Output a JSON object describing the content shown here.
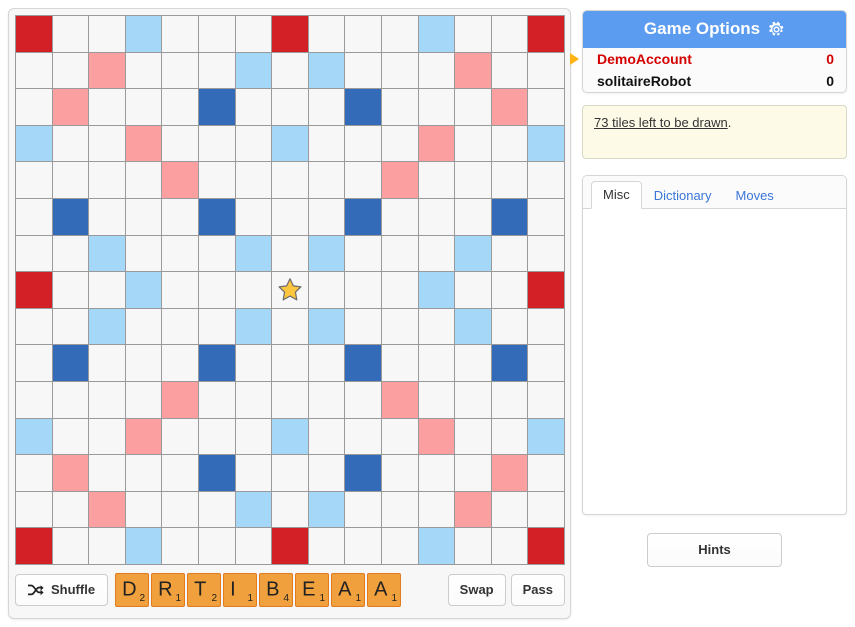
{
  "board": {
    "size": 15,
    "center_icon": "star-icon",
    "legend": {
      "tw": "triple-word",
      "dw": "double-word",
      "tl": "triple-letter",
      "dl": "double-letter"
    },
    "colors": {
      "triple_word": "#d32027",
      "double_word": "#fb9fa0",
      "triple_letter": "#336bb8",
      "double_letter": "#a5d7f9",
      "empty": "#f7f7f7",
      "grid_line": "#9a9a9a"
    },
    "premium_map": [
      [
        "tw",
        "",
        "",
        "dl",
        "",
        "",
        "",
        "tw",
        "",
        "",
        "",
        "dl",
        "",
        "",
        "tw"
      ],
      [
        "",
        "",
        "dw",
        "",
        "",
        "",
        "dl",
        "",
        "dl",
        "",
        "",
        "",
        "dw",
        "",
        ""
      ],
      [
        "",
        "dw",
        "",
        "",
        "",
        "tl",
        "",
        "",
        "",
        "tl",
        "",
        "",
        "",
        "dw",
        ""
      ],
      [
        "dl",
        "",
        "",
        "dw",
        "",
        "",
        "",
        "dl",
        "",
        "",
        "",
        "dw",
        "",
        "",
        "dl"
      ],
      [
        "",
        "",
        "",
        "",
        "dw",
        "",
        "",
        "",
        "",
        "",
        "dw",
        "",
        "",
        "",
        ""
      ],
      [
        "",
        "tl",
        "",
        "",
        "",
        "tl",
        "",
        "",
        "",
        "tl",
        "",
        "",
        "",
        "tl",
        ""
      ],
      [
        "",
        "",
        "dl",
        "",
        "",
        "",
        "dl",
        "",
        "dl",
        "",
        "",
        "",
        "dl",
        "",
        ""
      ],
      [
        "tw",
        "",
        "",
        "dl",
        "",
        "",
        "",
        "center",
        "",
        "",
        "",
        "dl",
        "",
        "",
        "tw"
      ],
      [
        "",
        "",
        "dl",
        "",
        "",
        "",
        "dl",
        "",
        "dl",
        "",
        "",
        "",
        "dl",
        "",
        ""
      ],
      [
        "",
        "tl",
        "",
        "",
        "",
        "tl",
        "",
        "",
        "",
        "tl",
        "",
        "",
        "",
        "tl",
        ""
      ],
      [
        "",
        "",
        "",
        "",
        "dw",
        "",
        "",
        "",
        "",
        "",
        "dw",
        "",
        "",
        "",
        ""
      ],
      [
        "dl",
        "",
        "",
        "dw",
        "",
        "",
        "",
        "dl",
        "",
        "",
        "",
        "dw",
        "",
        "",
        "dl"
      ],
      [
        "",
        "dw",
        "",
        "",
        "",
        "tl",
        "",
        "",
        "",
        "tl",
        "",
        "",
        "",
        "dw",
        ""
      ],
      [
        "",
        "",
        "dw",
        "",
        "",
        "",
        "dl",
        "",
        "dl",
        "",
        "",
        "",
        "dw",
        "",
        ""
      ],
      [
        "tw",
        "",
        "",
        "dl",
        "",
        "",
        "",
        "tw",
        "",
        "",
        "",
        "dl",
        "",
        "",
        "tw"
      ]
    ]
  },
  "actions": {
    "shuffle_label": "Shuffle",
    "shuffle_icon": "shuffle-icon",
    "swap_label": "Swap",
    "pass_label": "Pass"
  },
  "rack": {
    "tiles": [
      {
        "letter": "D",
        "points": "2"
      },
      {
        "letter": "R",
        "points": "1"
      },
      {
        "letter": "T",
        "points": "2"
      },
      {
        "letter": "I",
        "points": "1"
      },
      {
        "letter": "B",
        "points": "4"
      },
      {
        "letter": "E",
        "points": "1"
      },
      {
        "letter": "A",
        "points": "1"
      },
      {
        "letter": "A",
        "points": "1"
      }
    ],
    "tile_color": "#f0a03c",
    "tile_border_color": "#e07b20"
  },
  "options": {
    "title": "Game Options",
    "gear_icon": "gear-icon",
    "header_color": "#5b9bf0"
  },
  "players": [
    {
      "name": "DemoAccount",
      "score": "0",
      "active": true,
      "color": "#d40000"
    },
    {
      "name": "solitaireRobot",
      "score": "0",
      "active": false,
      "color": "#111111"
    }
  ],
  "message": {
    "link_text": "73 tiles left to be drawn",
    "suffix": "."
  },
  "tabs": [
    {
      "label": "Misc",
      "active": true
    },
    {
      "label": "Dictionary",
      "active": false
    },
    {
      "label": "Moves",
      "active": false
    }
  ],
  "hints": {
    "label": "Hints"
  }
}
